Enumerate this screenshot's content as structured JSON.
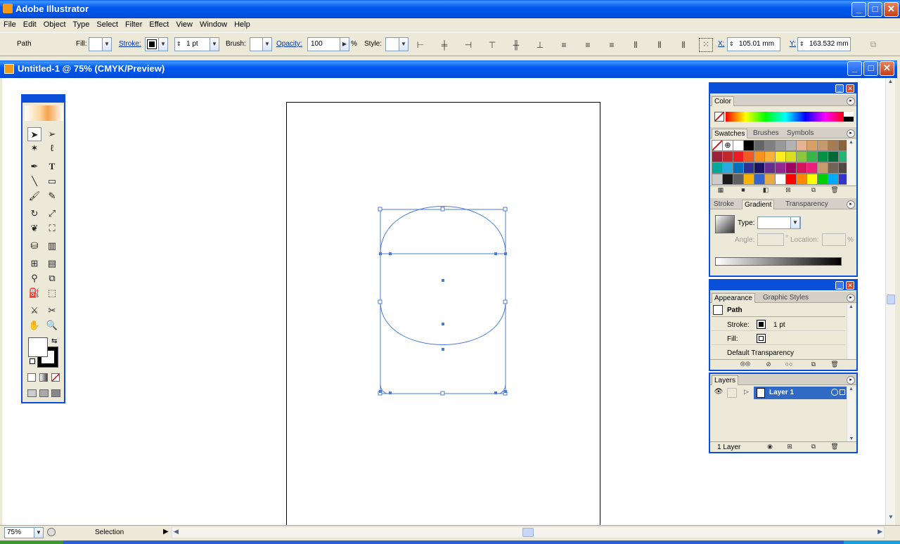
{
  "app": {
    "title": "Adobe Illustrator"
  },
  "menu": [
    "File",
    "Edit",
    "Object",
    "Type",
    "Select",
    "Filter",
    "Effect",
    "View",
    "Window",
    "Help"
  ],
  "control": {
    "object_type": "Path",
    "fill_label": "Fill:",
    "stroke_label": "Stroke:",
    "stroke_weight": "1 pt",
    "brush_label": "Brush:",
    "opacity_label": "Opacity:",
    "opacity_value": "100",
    "percent": "%",
    "style_label": "Style:",
    "x_label": "X:",
    "x_value": "105.01 mm",
    "y_label": "Y:",
    "y_value": "163.532 mm"
  },
  "document": {
    "title": "Untitled-1 @ 75% (CMYK/Preview)"
  },
  "status": {
    "zoom": "75%",
    "tool": "Selection"
  },
  "color_panel": {
    "tab": "Color"
  },
  "swatches_panel": {
    "tabs": [
      "Swatches",
      "Brushes",
      "Symbols"
    ]
  },
  "stroke_panel": {
    "tabs": [
      "Stroke",
      "Gradient",
      "Transparency"
    ],
    "type_label": "Type:",
    "angle_label": "Angle:",
    "deg": "°",
    "location_label": "Location:",
    "pct": "%"
  },
  "appearance_panel": {
    "tabs": [
      "Appearance",
      "Graphic Styles"
    ],
    "item": "Path",
    "stroke_label": "Stroke:",
    "stroke_value": "1 pt",
    "fill_label": "Fill:",
    "transparency": "Default Transparency"
  },
  "layers_panel": {
    "tab": "Layers",
    "layer_name": "Layer 1",
    "count": "1 Layer"
  },
  "colors": {
    "accent": "#0a4fd8",
    "selection": "#4a7bd8",
    "layer_highlight": "#316ac5"
  },
  "swatches": [
    [
      "none",
      "reg",
      "#ffffff",
      "#000000",
      "#666666",
      "#808080",
      "#999999",
      "#b3b3b3",
      "#e6b391",
      "#d9a066",
      "#c49a6c",
      "#a67c52",
      "#8c6239"
    ],
    [
      "#9e1f3a",
      "#c1272d",
      "#ed1c24",
      "#f15a24",
      "#f7931e",
      "#fbb03b",
      "#fcee21",
      "#d9e021",
      "#8cc63f",
      "#39b54a",
      "#009245",
      "#006837",
      "#22b573"
    ],
    [
      "#00a99d",
      "#29abe2",
      "#0071bc",
      "#2e3192",
      "#1b1464",
      "#662d91",
      "#93278f",
      "#9e005d",
      "#d4145a",
      "#ed1e79",
      "#c69c6d",
      "#736357",
      "#534741"
    ],
    [
      "#cccccc",
      "#1a1a1a",
      "#606060",
      "#f7b300",
      "#3366cc",
      "#e8aa44",
      "#ffffff",
      "#ff0000",
      "#ff8800",
      "#ffff00",
      "#00cc00",
      "#00aaff",
      "#3333cc"
    ]
  ]
}
